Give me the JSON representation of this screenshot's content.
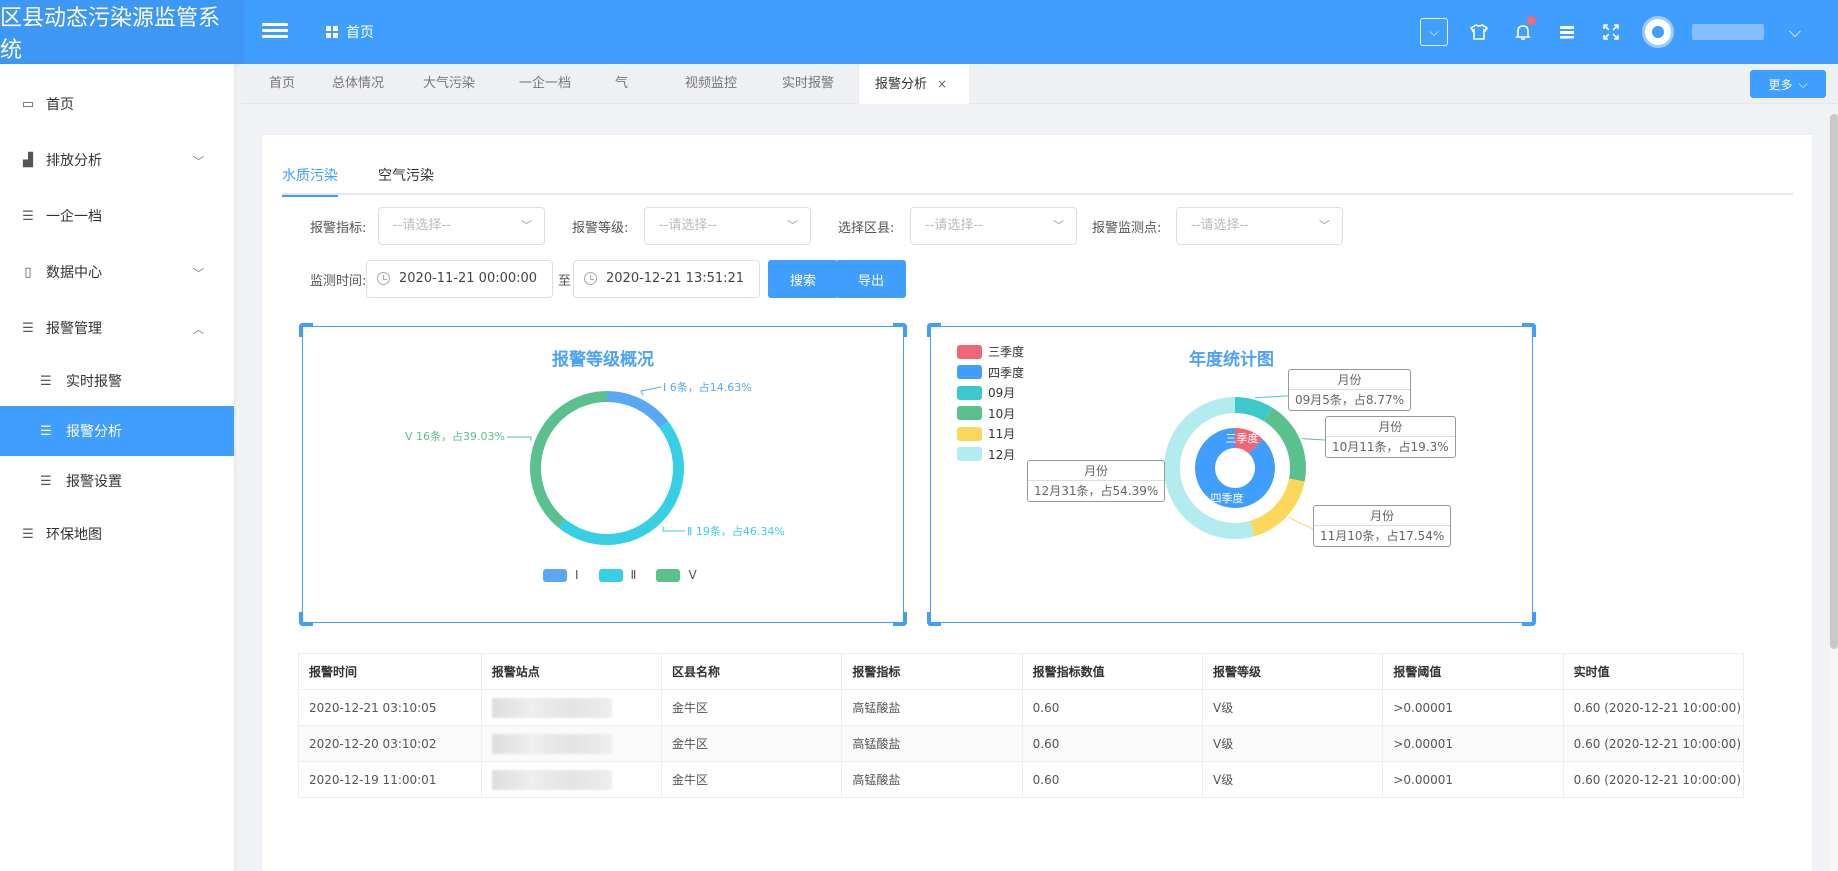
{
  "app": {
    "title": "区县动态污染源监管系统"
  },
  "breadcrumb": {
    "home": "首页"
  },
  "header_icons": [
    "chevron-down-box-icon",
    "tshirt-icon",
    "bell-icon",
    "grid-icon",
    "fullscreen-icon"
  ],
  "sidebar": {
    "items": [
      {
        "label": "首页",
        "icon": "monitor-icon"
      },
      {
        "label": "排放分析",
        "icon": "bar-chart-icon"
      },
      {
        "label": "一企一档",
        "icon": "list-icon"
      },
      {
        "label": "数据中心",
        "icon": "book-icon"
      },
      {
        "label": "报警管理",
        "icon": "list-icon"
      },
      {
        "label": "实时报警",
        "icon": "list-icon"
      },
      {
        "label": "报警分析",
        "icon": "list-icon"
      },
      {
        "label": "报警设置",
        "icon": "list-icon"
      },
      {
        "label": "环保地图",
        "icon": "list-icon"
      }
    ]
  },
  "tabs": [
    {
      "label": "首页"
    },
    {
      "label": "总体情况"
    },
    {
      "label": "大气污染"
    },
    {
      "label": "一企一档"
    },
    {
      "label": "气"
    },
    {
      "label": "视频监控"
    },
    {
      "label": "实时报警"
    },
    {
      "label": "报警分析"
    }
  ],
  "more_button": "更多",
  "page_tabs": [
    {
      "label": "水质污染"
    },
    {
      "label": "空气污染"
    }
  ],
  "filters": {
    "indicator_label": "报警指标:",
    "level_label": "报警等级:",
    "district_label": "选择区县:",
    "point_label": "报警监测点:",
    "placeholder": "--请选择--",
    "time_label": "监测时间:",
    "start_time": "2020-11-21 00:00:00",
    "to": "至",
    "end_time": "2020-12-21 13:51:21",
    "search_button": "搜索",
    "export_button": "导出"
  },
  "chart_data": [
    {
      "type": "pie",
      "title": "报警等级概况",
      "categories": [
        "Ⅰ",
        "Ⅱ",
        "Ⅴ"
      ],
      "values": [
        6,
        19,
        16
      ],
      "percent": [
        14.63,
        46.34,
        39.03
      ],
      "data_labels": [
        "Ⅰ 6条，占14.63%",
        "Ⅱ 19条，占46.34%",
        "Ⅴ 16条，占39.03%"
      ],
      "colors": [
        "#5aa7f5",
        "#36cfe4",
        "#5ac18e"
      ],
      "legend": [
        "Ⅰ",
        "Ⅱ",
        "Ⅴ"
      ],
      "legend_position": "bottom"
    },
    {
      "type": "pie",
      "title": "年度统计图",
      "legend": [
        "三季度",
        "四季度",
        "09月",
        "10月",
        "11月",
        "12月"
      ],
      "legend_position": "top-left",
      "legend_colors": [
        "#ef6677",
        "#409eff",
        "#3cc9cc",
        "#5ac18e",
        "#fbd75c",
        "#b3ecee"
      ],
      "inner_ring": {
        "categories": [
          "三季度",
          "四季度"
        ],
        "values": [
          5,
          36
        ]
      },
      "outer_ring": {
        "categories": [
          "09月",
          "10月",
          "11月",
          "12月"
        ],
        "values": [
          5,
          11,
          10,
          31
        ],
        "percent": [
          8.77,
          19.3,
          17.54,
          54.39
        ]
      },
      "tooltip_title": "月份",
      "tooltip_labels": [
        "09月5条，占8.77%",
        "10月11条，占19.3%",
        "11月10条，占17.54%",
        "12月31条，占54.39%"
      ]
    }
  ],
  "table": {
    "headers": [
      "报警时间",
      "报警站点",
      "区县名称",
      "报警指标",
      "报警指标数值",
      "报警等级",
      "报警阈值",
      "实时值"
    ],
    "rows": [
      [
        "2020-12-21 03:10:05",
        "",
        "金牛区",
        "高锰酸盐",
        "0.60",
        "Ⅴ级",
        ">0.00001",
        "0.60 (2020-12-21 10:00:00)"
      ],
      [
        "2020-12-20 03:10:02",
        "",
        "金牛区",
        "高锰酸盐",
        "0.60",
        "Ⅴ级",
        ">0.00001",
        "0.60 (2020-12-21 10:00:00)"
      ],
      [
        "2020-12-19 11:00:01",
        "",
        "金牛区",
        "高锰酸盐",
        "0.60",
        "Ⅴ级",
        ">0.00001",
        "0.60 (2020-12-21 10:00:00)"
      ]
    ]
  }
}
